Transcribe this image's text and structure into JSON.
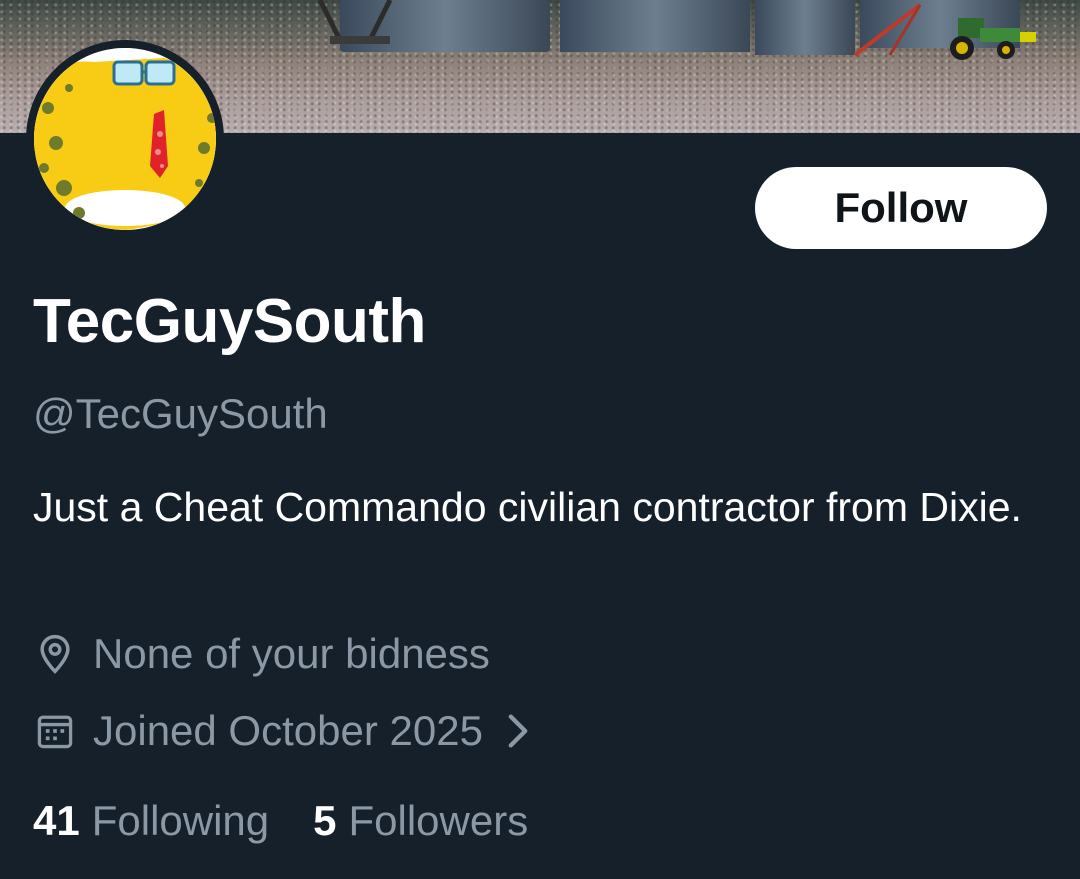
{
  "profile": {
    "display_name": "TecGuySouth",
    "handle": "@TecGuySouth",
    "bio": "Just a Cheat Commando civilian contractor from Dixie.",
    "location": "None of your bidness",
    "joined": "Joined October 2025",
    "following_count": "41",
    "following_label": "Following",
    "followers_count": "5",
    "followers_label": "Followers"
  },
  "actions": {
    "follow_label": "Follow"
  },
  "icons": {
    "location": "map-pin-icon",
    "joined": "calendar-icon",
    "chevron": "chevron-right-icon"
  },
  "colors": {
    "background": "#16202a",
    "secondary_text": "#8b98a5",
    "primary_text": "#ffffff",
    "follow_button_bg": "#ffffff",
    "follow_button_text": "#0f1419"
  }
}
